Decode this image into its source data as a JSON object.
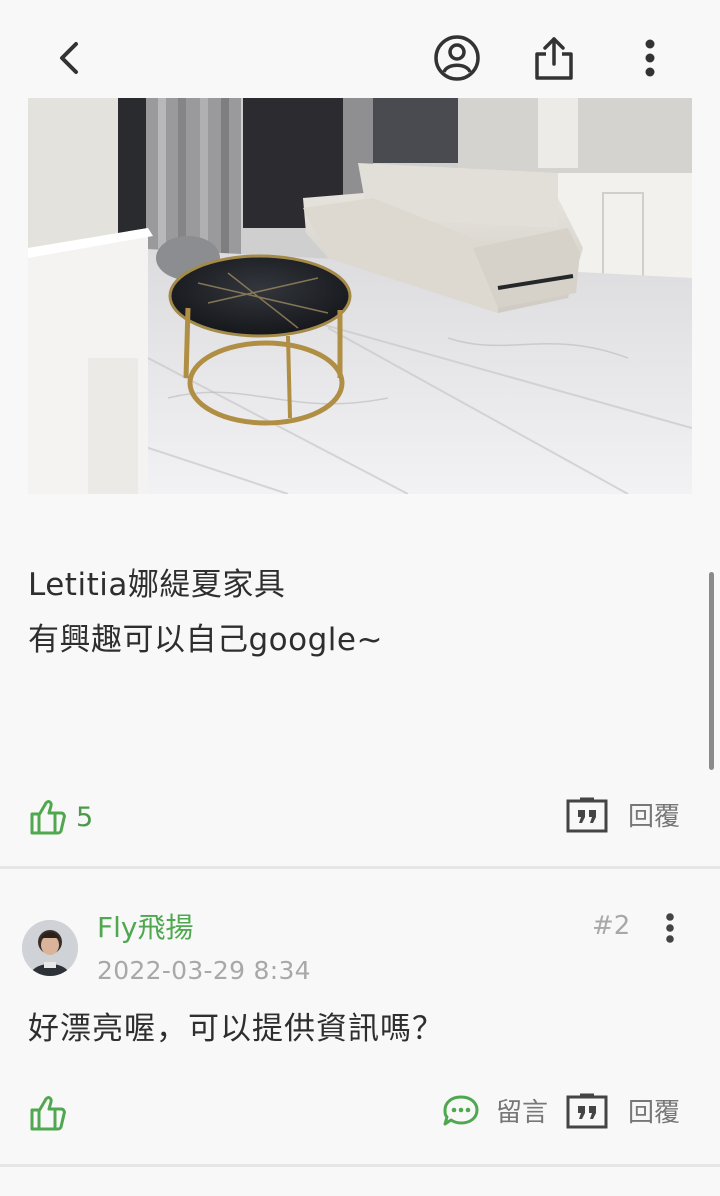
{
  "header": {
    "back_icon": "chevron-left-icon",
    "profile_icon": "user-circle-icon",
    "share_icon": "share-icon",
    "more_icon": "vertical-dots-icon"
  },
  "post": {
    "text_lines": [
      "Letitia娜緹夏家具",
      "有興趣可以自己google~"
    ],
    "like_count": "5",
    "reply_label": "回覆"
  },
  "comment": {
    "author": "Fly飛揚",
    "timestamp": "2022-03-29 8:34",
    "floor": "#2",
    "text": "好漂亮喔，可以提供資訊嗎？",
    "comment_label": "留言",
    "reply_label": "回覆"
  },
  "colors": {
    "accent_green": "#4fa84f",
    "text_dark": "#2e2e2e",
    "text_gray": "#a8a8a8",
    "background": "#f8f8f8"
  }
}
